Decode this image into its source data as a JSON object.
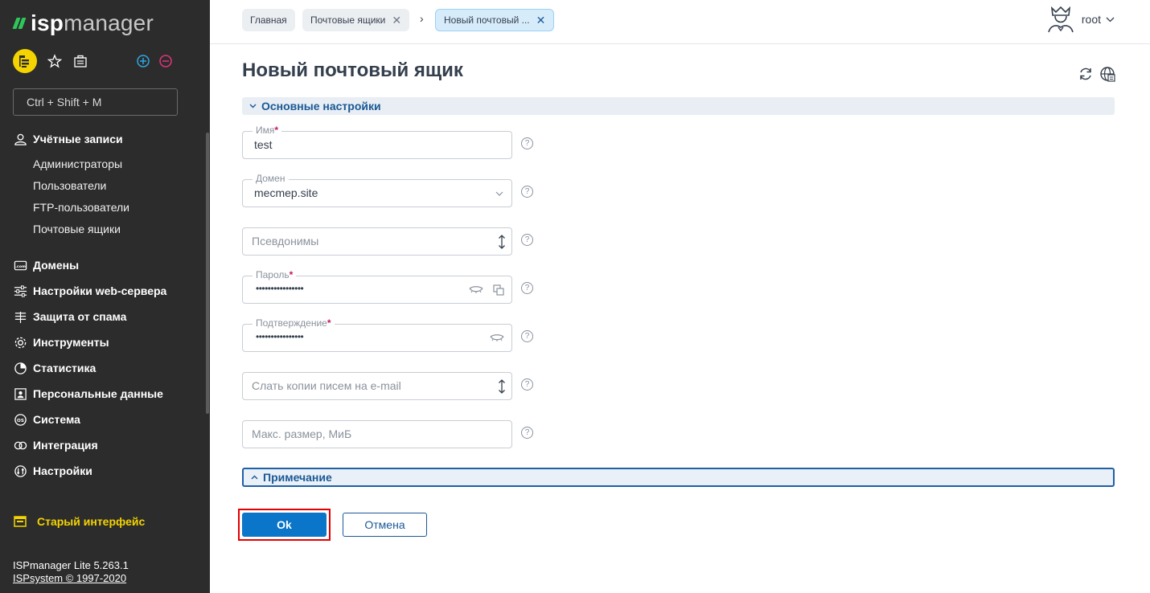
{
  "app": {
    "logo_bold": "isp",
    "logo_rest": "manager"
  },
  "sidebar": {
    "search_placeholder": "Ctrl + Shift + M",
    "groups": [
      {
        "label": "Учётные записи",
        "icon": "user-icon"
      },
      {
        "label": "Домены",
        "icon": "domain-icon"
      },
      {
        "label": "Настройки web-сервера",
        "icon": "sliders-icon"
      },
      {
        "label": "Защита от спама",
        "icon": "spam-filter-icon"
      },
      {
        "label": "Инструменты",
        "icon": "gear-icon"
      },
      {
        "label": "Статистика",
        "icon": "pie-chart-icon"
      },
      {
        "label": "Персональные данные",
        "icon": "personal-data-icon"
      },
      {
        "label": "Система",
        "icon": "os-icon"
      },
      {
        "label": "Интеграция",
        "icon": "integration-icon"
      },
      {
        "label": "Настройки",
        "icon": "settings-icon"
      }
    ],
    "subitems": [
      "Администраторы",
      "Пользователи",
      "FTP-пользователи",
      "Почтовые ящики"
    ],
    "old_interface": "Старый интерфейс",
    "version": "ISPmanager Lite 5.263.1",
    "copyright": "ISPsystem © 1997-2020"
  },
  "header": {
    "breadcrumbs": [
      "Главная",
      "Почтовые ящики",
      "Новый почтовый ..."
    ],
    "separator": "›",
    "user": "root"
  },
  "page": {
    "title": "Новый почтовый ящик",
    "section_main": "Основные настройки",
    "section_note": "Примечание"
  },
  "form": {
    "name": {
      "label": "Имя",
      "value": "test"
    },
    "domain": {
      "label": "Домен",
      "value": "mecmep.site"
    },
    "aliases": {
      "placeholder": "Псевдонимы"
    },
    "password": {
      "label": "Пароль",
      "value": "••••••••••••••••"
    },
    "confirm": {
      "label": "Подтверждение",
      "value": "••••••••••••••••"
    },
    "forward": {
      "placeholder": "Слать копии писем на e-mail"
    },
    "maxsize": {
      "placeholder": "Макс. размер, МиБ"
    },
    "required_mark": "*",
    "help_mark": "?"
  },
  "actions": {
    "ok": "Ok",
    "cancel": "Отмена"
  },
  "colors": {
    "sidebar_bg": "#2c2c2c",
    "accent": "#0a75c9",
    "old_ui": "#f4d300",
    "highlight": "#e40000"
  }
}
